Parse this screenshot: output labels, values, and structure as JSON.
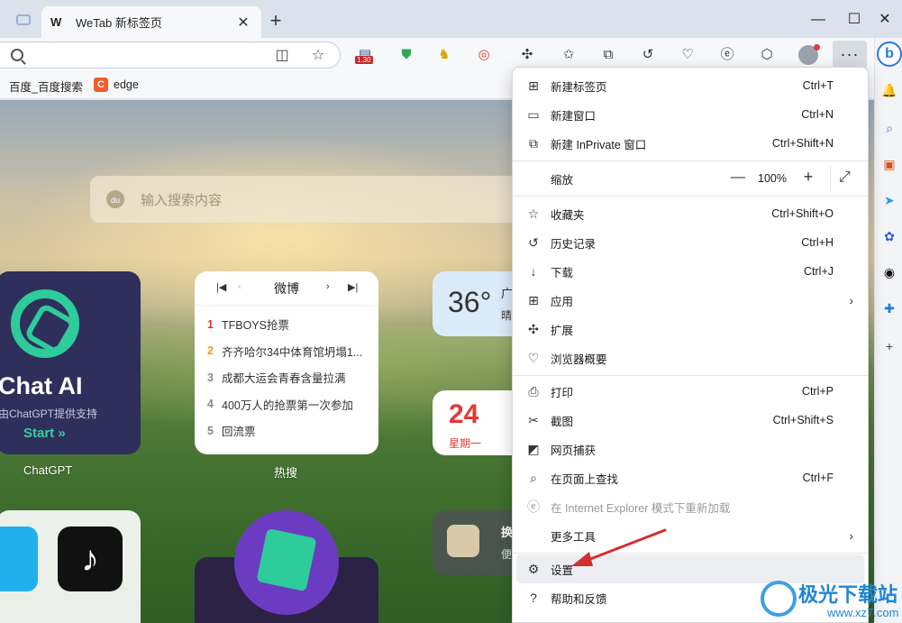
{
  "tab": {
    "title": "WeTab 新标签页",
    "logo": "W"
  },
  "toolbar": {
    "badge": "1.30"
  },
  "favorites": [
    {
      "label": "百度_百度搜索"
    },
    {
      "label": "edge",
      "icon": "C"
    }
  ],
  "page": {
    "search_placeholder": "输入搜索内容",
    "chat_card": {
      "title": "Chat AI",
      "subtitle": "由ChatGPT提供支持",
      "start": "Start »",
      "caption": "ChatGPT"
    },
    "hot_card": {
      "title": "微博",
      "caption": "热搜",
      "items": [
        {
          "rank": "1",
          "text": "TFBOYS抢票",
          "color": "#e53935"
        },
        {
          "rank": "2",
          "text": "齐齐哈尔34中体育馆坍塌1...",
          "color": "#f39c12"
        },
        {
          "rank": "3",
          "text": "成都大运会青春含量拉满",
          "color": "#888888"
        },
        {
          "rank": "4",
          "text": "400万人的抢票第一次参加",
          "color": "#888888"
        },
        {
          "rank": "5",
          "text": "回流票",
          "color": "#888888"
        }
      ]
    },
    "weather": {
      "temp": "36°",
      "city_partial": "广",
      "cond_partial": "晴"
    },
    "date": {
      "day": "24",
      "weekday": "星期一"
    },
    "calc": {
      "title_partial": "换",
      "sub_partial": "便"
    }
  },
  "menu": {
    "items": [
      {
        "id": "new-tab",
        "icon": "new-tab-icon",
        "glyph": "⊞",
        "label": "新建标签页",
        "shortcut": "Ctrl+T"
      },
      {
        "id": "new-window",
        "icon": "new-window-icon",
        "glyph": "▭",
        "label": "新建窗口",
        "shortcut": "Ctrl+N"
      },
      {
        "id": "new-inprivate",
        "icon": "inprivate-icon",
        "glyph": "⧉",
        "label": "新建 InPrivate 窗口",
        "shortcut": "Ctrl+Shift+N"
      },
      {
        "id": "favorites",
        "icon": "favorites-icon",
        "glyph": "☆",
        "label": "收藏夹",
        "shortcut": "Ctrl+Shift+O"
      },
      {
        "id": "history",
        "icon": "history-icon",
        "glyph": "↺",
        "label": "历史记录",
        "shortcut": "Ctrl+H"
      },
      {
        "id": "downloads",
        "icon": "download-icon",
        "glyph": "↓",
        "label": "下载",
        "shortcut": "Ctrl+J"
      },
      {
        "id": "apps",
        "icon": "apps-icon",
        "glyph": "⊞",
        "label": "应用",
        "shortcut": ""
      },
      {
        "id": "extensions",
        "icon": "extensions-icon",
        "glyph": "✣",
        "label": "扩展",
        "shortcut": ""
      },
      {
        "id": "browser-essentials",
        "icon": "heart-pulse-icon",
        "glyph": "♡",
        "label": "浏览器概要",
        "shortcut": ""
      },
      {
        "id": "print",
        "icon": "print-icon",
        "glyph": "⎙",
        "label": "打印",
        "shortcut": "Ctrl+P"
      },
      {
        "id": "screenshot",
        "icon": "screenshot-icon",
        "glyph": "✂",
        "label": "截图",
        "shortcut": "Ctrl+Shift+S"
      },
      {
        "id": "web-capture",
        "icon": "web-capture-icon",
        "glyph": "◩",
        "label": "网页捕获",
        "shortcut": ""
      },
      {
        "id": "find",
        "icon": "find-icon",
        "glyph": "⌕",
        "label": "在页面上查找",
        "shortcut": "Ctrl+F"
      },
      {
        "id": "ie-mode",
        "icon": "ie-icon",
        "glyph": "e",
        "label": "在 Internet Explorer 模式下重新加载",
        "shortcut": ""
      },
      {
        "id": "more-tools",
        "icon": "tools-icon",
        "glyph": "",
        "label": "更多工具",
        "shortcut": ""
      },
      {
        "id": "settings",
        "icon": "gear-icon",
        "glyph": "⚙",
        "label": "设置",
        "shortcut": ""
      },
      {
        "id": "help",
        "icon": "help-icon",
        "glyph": "?",
        "label": "帮助和反馈",
        "shortcut": ""
      }
    ],
    "zoom": {
      "label": "缩放",
      "value": "100%",
      "minus": "—",
      "plus": "+"
    }
  },
  "watermark": {
    "brand": "极光下载站",
    "url": "www.xz7.com"
  },
  "colors": {
    "accent": "#2a7ae4",
    "arrow": "#d32f2f",
    "chat_green": "#2ecc9a"
  }
}
